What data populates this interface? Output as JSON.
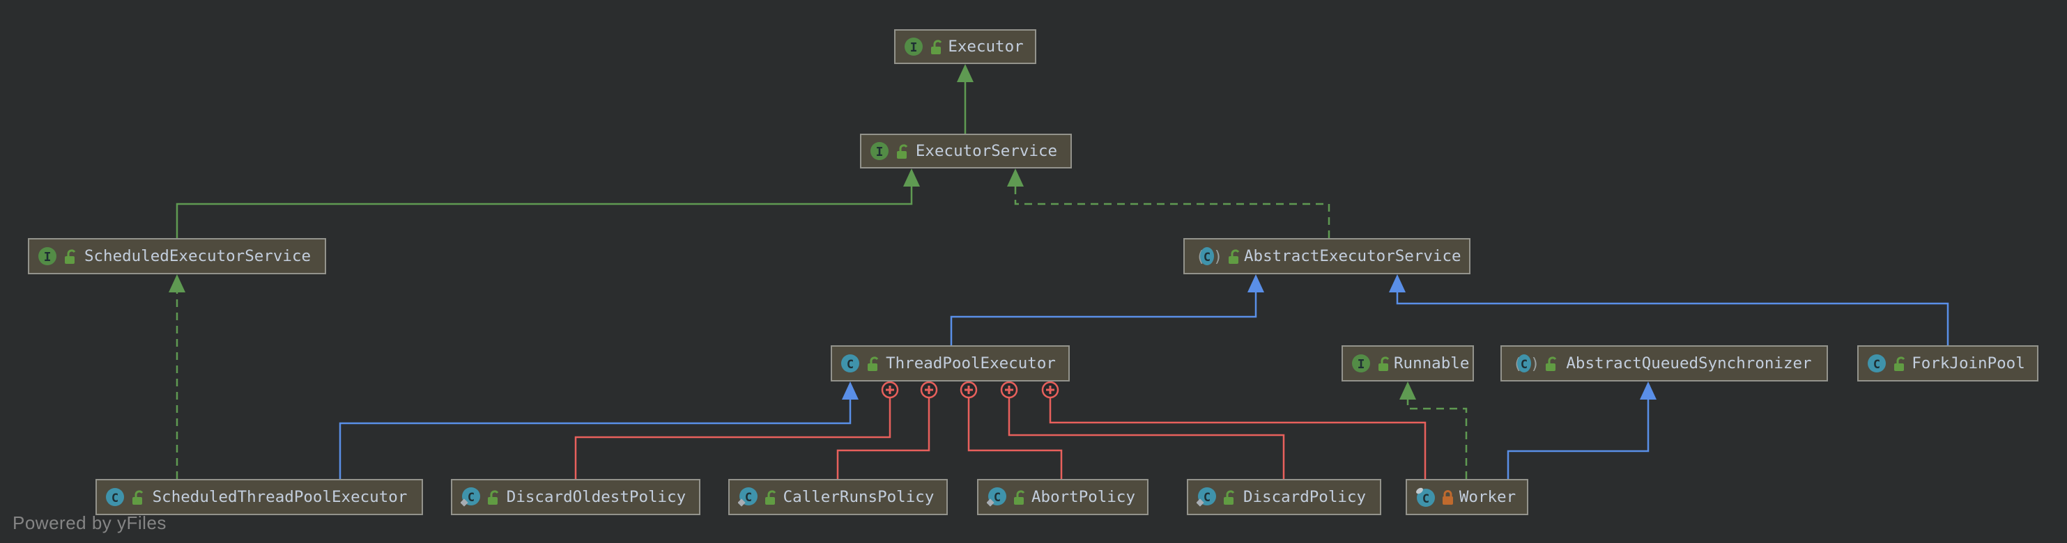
{
  "diagram": {
    "watermark": "Powered by yFiles",
    "colors": {
      "background": "#2b2d2e",
      "node_fill": "#4f4b3e",
      "node_border": "#93938c",
      "node_text": "#c3cedd",
      "edge_extends_interface": "#5f9a52",
      "edge_extends_class": "#5a8fe8",
      "edge_inner_class": "#e8605c",
      "icon_interface": "#538c46",
      "icon_class": "#3f93ab",
      "icon_abstract_paren": "#9aa0a0",
      "icon_letter": "#1e2e33",
      "lock_public": "#619c43",
      "lock_private": "#bf6a2e",
      "static_marker": "#a8adb3",
      "inner_marker": "#c2c8cc",
      "watermark_color": "#858585"
    },
    "nodes": {
      "executor": {
        "label": "Executor",
        "kind": "interface",
        "visibility": "public"
      },
      "executor_service": {
        "label": "ExecutorService",
        "kind": "interface",
        "visibility": "public"
      },
      "scheduled_executor_service": {
        "label": "ScheduledExecutorService",
        "kind": "interface",
        "visibility": "public"
      },
      "abstract_executor_service": {
        "label": "AbstractExecutorService",
        "kind": "abstract-class",
        "visibility": "public"
      },
      "thread_pool_executor": {
        "label": "ThreadPoolExecutor",
        "kind": "class",
        "visibility": "public"
      },
      "runnable": {
        "label": "Runnable",
        "kind": "interface",
        "visibility": "public"
      },
      "abstract_queued_synchronizer": {
        "label": "AbstractQueuedSynchronizer",
        "kind": "abstract-class",
        "visibility": "public"
      },
      "fork_join_pool": {
        "label": "ForkJoinPool",
        "kind": "class",
        "visibility": "public"
      },
      "scheduled_thread_pool_executor": {
        "label": "ScheduledThreadPoolExecutor",
        "kind": "class",
        "visibility": "public"
      },
      "discard_oldest_policy": {
        "label": "DiscardOldestPolicy",
        "kind": "static-nested-class",
        "visibility": "public"
      },
      "caller_runs_policy": {
        "label": "CallerRunsPolicy",
        "kind": "static-nested-class",
        "visibility": "public"
      },
      "abort_policy": {
        "label": "AbortPolicy",
        "kind": "static-nested-class",
        "visibility": "public"
      },
      "discard_policy": {
        "label": "DiscardPolicy",
        "kind": "static-nested-class",
        "visibility": "public"
      },
      "worker": {
        "label": "Worker",
        "kind": "inner-class",
        "visibility": "private"
      }
    },
    "edges": [
      {
        "from": "executor_service",
        "to": "executor",
        "relation": "extends",
        "style": "solid-green"
      },
      {
        "from": "scheduled_executor_service",
        "to": "executor_service",
        "relation": "extends",
        "style": "solid-green"
      },
      {
        "from": "abstract_executor_service",
        "to": "executor_service",
        "relation": "implements",
        "style": "dashed-green"
      },
      {
        "from": "thread_pool_executor",
        "to": "abstract_executor_service",
        "relation": "extends",
        "style": "solid-blue"
      },
      {
        "from": "fork_join_pool",
        "to": "abstract_executor_service",
        "relation": "extends",
        "style": "solid-blue"
      },
      {
        "from": "scheduled_thread_pool_executor",
        "to": "scheduled_executor_service",
        "relation": "implements",
        "style": "dashed-green"
      },
      {
        "from": "scheduled_thread_pool_executor",
        "to": "thread_pool_executor",
        "relation": "extends",
        "style": "solid-blue"
      },
      {
        "from": "worker",
        "to": "runnable",
        "relation": "implements",
        "style": "dashed-green"
      },
      {
        "from": "worker",
        "to": "abstract_queued_synchronizer",
        "relation": "extends",
        "style": "solid-blue"
      },
      {
        "from": "thread_pool_executor",
        "to": "discard_oldest_policy",
        "relation": "inner-class",
        "style": "solid-red"
      },
      {
        "from": "thread_pool_executor",
        "to": "caller_runs_policy",
        "relation": "inner-class",
        "style": "solid-red"
      },
      {
        "from": "thread_pool_executor",
        "to": "abort_policy",
        "relation": "inner-class",
        "style": "solid-red"
      },
      {
        "from": "thread_pool_executor",
        "to": "discard_policy",
        "relation": "inner-class",
        "style": "solid-red"
      },
      {
        "from": "thread_pool_executor",
        "to": "worker",
        "relation": "inner-class",
        "style": "solid-red"
      }
    ]
  }
}
